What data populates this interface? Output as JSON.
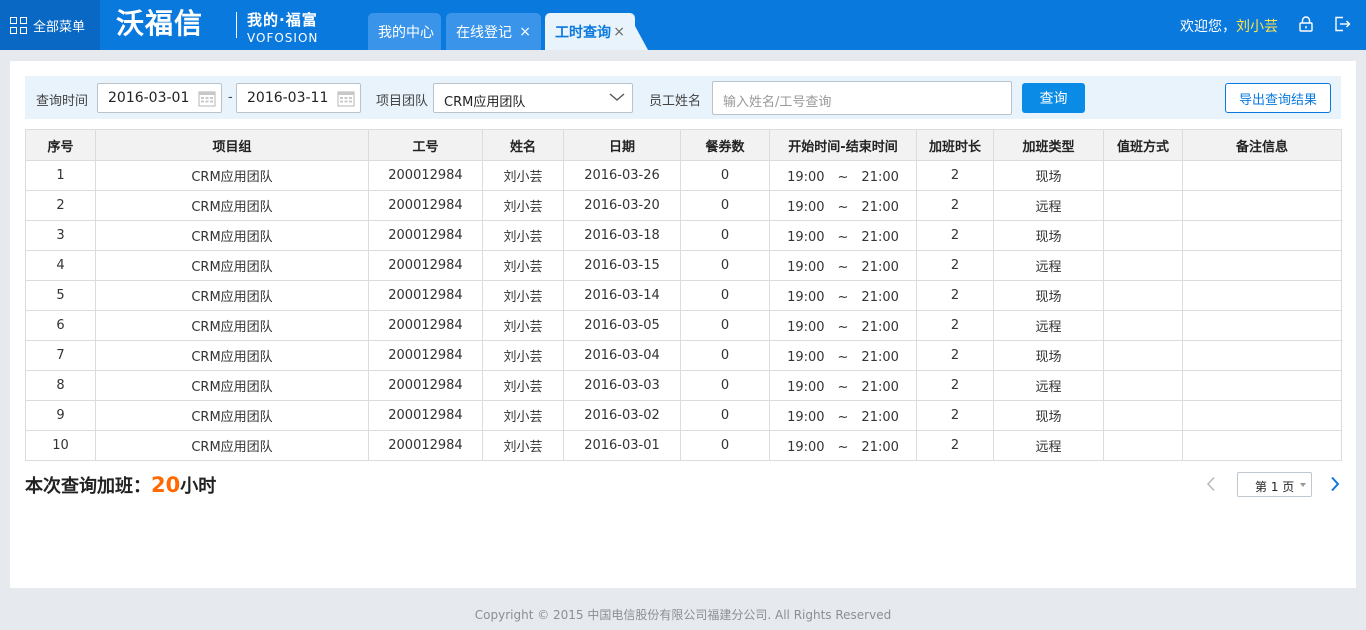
{
  "nav": {
    "menu_label": "全部菜单",
    "brand": "沃福信",
    "sub_brand_cn": "我的·福富",
    "sub_brand_en": "VOFOSION",
    "tabs": [
      {
        "label": "我的中心",
        "closable": false
      },
      {
        "label": "在线登记",
        "closable": true,
        "close": "×"
      },
      {
        "label": "工时查询",
        "closable": true,
        "close": "×",
        "active": true
      }
    ],
    "welcome": "欢迎您，",
    "user": "刘小芸"
  },
  "filter": {
    "time_label": "查询时间",
    "start_date": "2016-03-01",
    "separator": "-",
    "end_date": "2016-03-11",
    "team_label": "项目团队",
    "team_value": "CRM应用团队",
    "name_label": "员工姓名",
    "name_placeholder": "输入姓名/工号查询",
    "query_button": "查询",
    "export_button": "导出查询结果"
  },
  "table": {
    "headers": [
      "序号",
      "项目组",
      "工号",
      "姓名",
      "日期",
      "餐券数",
      "开始时间-结束时间",
      "加班时长",
      "加班类型",
      "值班方式",
      "备注信息"
    ],
    "rows": [
      [
        "1",
        "CRM应用团队",
        "200012984",
        "刘小芸",
        "2016-03-26",
        "0",
        "19:00　~　21:00",
        "2",
        "现场",
        "",
        ""
      ],
      [
        "2",
        "CRM应用团队",
        "200012984",
        "刘小芸",
        "2016-03-20",
        "0",
        "19:00　~　21:00",
        "2",
        "远程",
        "",
        ""
      ],
      [
        "3",
        "CRM应用团队",
        "200012984",
        "刘小芸",
        "2016-03-18",
        "0",
        "19:00　~　21:00",
        "2",
        "现场",
        "",
        ""
      ],
      [
        "4",
        "CRM应用团队",
        "200012984",
        "刘小芸",
        "2016-03-15",
        "0",
        "19:00　~　21:00",
        "2",
        "远程",
        "",
        ""
      ],
      [
        "5",
        "CRM应用团队",
        "200012984",
        "刘小芸",
        "2016-03-14",
        "0",
        "19:00　~　21:00",
        "2",
        "现场",
        "",
        ""
      ],
      [
        "6",
        "CRM应用团队",
        "200012984",
        "刘小芸",
        "2016-03-05",
        "0",
        "19:00　~　21:00",
        "2",
        "远程",
        "",
        ""
      ],
      [
        "7",
        "CRM应用团队",
        "200012984",
        "刘小芸",
        "2016-03-04",
        "0",
        "19:00　~　21:00",
        "2",
        "现场",
        "",
        ""
      ],
      [
        "8",
        "CRM应用团队",
        "200012984",
        "刘小芸",
        "2016-03-03",
        "0",
        "19:00　~　21:00",
        "2",
        "远程",
        "",
        ""
      ],
      [
        "9",
        "CRM应用团队",
        "200012984",
        "刘小芸",
        "2016-03-02",
        "0",
        "19:00　~　21:00",
        "2",
        "现场",
        "",
        ""
      ],
      [
        "10",
        "CRM应用团队",
        "200012984",
        "刘小芸",
        "2016-03-01",
        "0",
        "19:00　~　21:00",
        "2",
        "远程",
        "",
        ""
      ]
    ]
  },
  "summary": {
    "label": "本次查询加班：",
    "hours": "20",
    "unit": "小时"
  },
  "pagination": {
    "page_label": "第 1 页"
  },
  "footer": {
    "copyright": "Copyright © 2015 中国电信股份有限公司福建分公司. All Rights Reserved"
  },
  "icons": [
    "grid-menu-icon",
    "lock-icon",
    "logout-icon",
    "calendar-icon",
    "chevron-down-icon",
    "chevron-left-icon",
    "chevron-right-icon"
  ],
  "colors": {
    "primary": "#0a79de",
    "accent": "#ff6a00",
    "user": "#ffe44d"
  }
}
